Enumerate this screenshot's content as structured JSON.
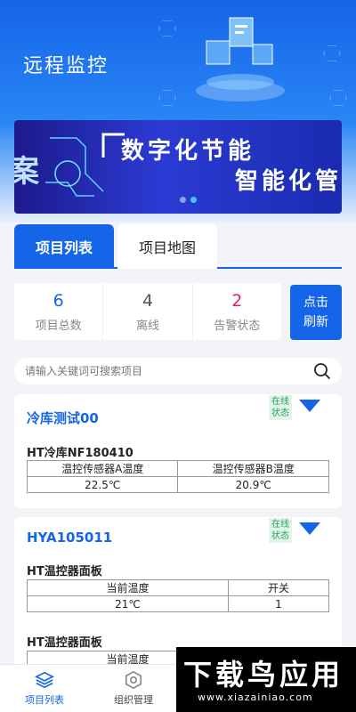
{
  "header": {
    "title": "远程监控"
  },
  "banner": {
    "left_text": "案",
    "line1": "数字化节能",
    "line2": "智能化管"
  },
  "tabs": [
    {
      "label": "项目列表",
      "active": true
    },
    {
      "label": "项目地图",
      "active": false
    }
  ],
  "stats": [
    {
      "value": "6",
      "label": "项目总数",
      "color": "#1565e8"
    },
    {
      "value": "4",
      "label": "离线",
      "color": "#555555"
    },
    {
      "value": "2",
      "label": "告警状态",
      "color": "#e0245e"
    }
  ],
  "refresh_label": "点击刷新",
  "search": {
    "placeholder": "请输入关键词可搜索项目"
  },
  "projects": [
    {
      "name": "冷库测试00",
      "status": "在线状态",
      "devices": [
        {
          "name": "HT冷库NF180410",
          "headers": [
            "温控传感器A温度",
            "温控传感器B温度"
          ],
          "values": [
            "22.5℃",
            "20.9℃"
          ]
        }
      ]
    },
    {
      "name": "HYA105011",
      "status": "在线状态",
      "devices": [
        {
          "name": "HT温控器面板",
          "headers": [
            "当前温度",
            "开关"
          ],
          "values": [
            "21℃",
            "1"
          ]
        },
        {
          "name": "HT温控器面板",
          "headers": [
            "当前温度"
          ],
          "values": []
        }
      ]
    }
  ],
  "bottom_nav": [
    {
      "label": "项目列表",
      "icon": "layers-icon",
      "active": true
    },
    {
      "label": "组织管理",
      "icon": "hexagon-nut-icon",
      "active": false
    }
  ],
  "watermark": {
    "big": "下载",
    "big2": "应用",
    "bird": "鸟",
    "url": "www.xiazainiao.com"
  },
  "colors": {
    "primary": "#1565e8",
    "online": "#23a35a",
    "alarm": "#e0245e"
  }
}
